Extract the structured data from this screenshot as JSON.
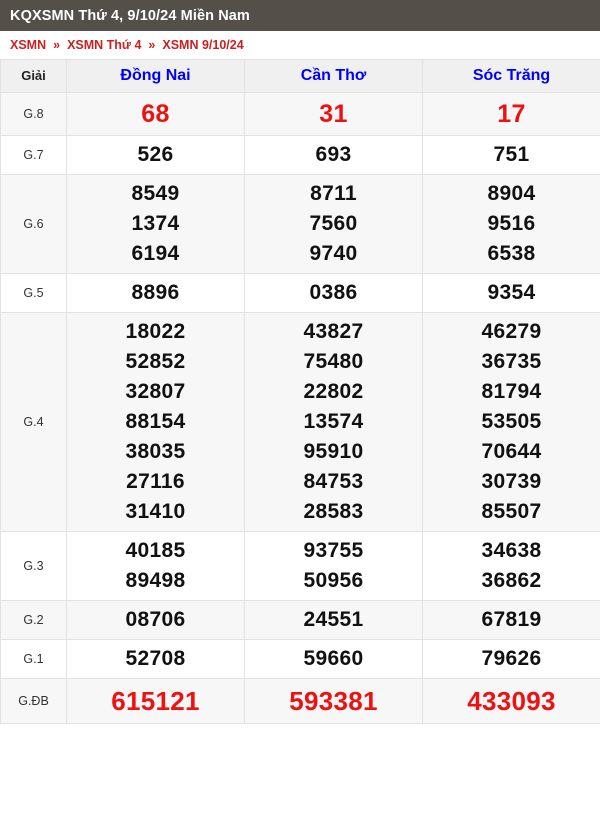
{
  "header": {
    "title": "KQXSMN Thứ 4, 9/10/24 Miền Nam"
  },
  "breadcrumb": {
    "separator": "»",
    "items": [
      {
        "label": "XSMN"
      },
      {
        "label": "XSMN Thứ 4"
      },
      {
        "label": "XSMN 9/10/24"
      }
    ]
  },
  "table": {
    "columns": [
      {
        "label": "Giải",
        "type": "prize-label"
      },
      {
        "label": "Đồng Nai",
        "type": "province"
      },
      {
        "label": "Cần Thơ",
        "type": "province"
      },
      {
        "label": "Sóc Trăng",
        "type": "province"
      }
    ],
    "rows": [
      {
        "prize": "G.8",
        "style": "red",
        "size": "big",
        "shade": true,
        "dong_nai": [
          "68"
        ],
        "can_tho": [
          "31"
        ],
        "soc_trang": [
          "17"
        ]
      },
      {
        "prize": "G.7",
        "style": "black",
        "size": "normal",
        "shade": false,
        "dong_nai": [
          "526"
        ],
        "can_tho": [
          "693"
        ],
        "soc_trang": [
          "751"
        ]
      },
      {
        "prize": "G.6",
        "style": "black",
        "size": "normal",
        "shade": true,
        "dong_nai": [
          "8549",
          "1374",
          "6194"
        ],
        "can_tho": [
          "8711",
          "7560",
          "9740"
        ],
        "soc_trang": [
          "8904",
          "9516",
          "6538"
        ]
      },
      {
        "prize": "G.5",
        "style": "black",
        "size": "normal",
        "shade": false,
        "dong_nai": [
          "8896"
        ],
        "can_tho": [
          "0386"
        ],
        "soc_trang": [
          "9354"
        ]
      },
      {
        "prize": "G.4",
        "style": "black",
        "size": "normal",
        "shade": true,
        "dong_nai": [
          "18022",
          "52852",
          "32807",
          "88154",
          "38035",
          "27116",
          "31410"
        ],
        "can_tho": [
          "43827",
          "75480",
          "22802",
          "13574",
          "95910",
          "84753",
          "28583"
        ],
        "soc_trang": [
          "46279",
          "36735",
          "81794",
          "53505",
          "70644",
          "30739",
          "85507"
        ]
      },
      {
        "prize": "G.3",
        "style": "black",
        "size": "normal",
        "shade": false,
        "dong_nai": [
          "40185",
          "89498"
        ],
        "can_tho": [
          "93755",
          "50956"
        ],
        "soc_trang": [
          "34638",
          "36862"
        ]
      },
      {
        "prize": "G.2",
        "style": "black",
        "size": "normal",
        "shade": true,
        "dong_nai": [
          "08706"
        ],
        "can_tho": [
          "24551"
        ],
        "soc_trang": [
          "67819"
        ]
      },
      {
        "prize": "G.1",
        "style": "black",
        "size": "normal",
        "shade": false,
        "dong_nai": [
          "52708"
        ],
        "can_tho": [
          "59660"
        ],
        "soc_trang": [
          "79626"
        ]
      },
      {
        "prize": "G.ĐB",
        "style": "red",
        "size": "special",
        "shade": true,
        "dong_nai": [
          "615121"
        ],
        "can_tho": [
          "593381"
        ],
        "soc_trang": [
          "433093"
        ]
      }
    ]
  },
  "colors": {
    "titlebar_bg": "#554f4a",
    "breadcrumb_link": "#cc2020",
    "province_header": "#0000ff",
    "highlight_number": "#ee1111",
    "number": "#111111",
    "row_shade": "#f7f7f7",
    "row_plain": "#ffffff",
    "header_bg": "#f0f0f0"
  }
}
